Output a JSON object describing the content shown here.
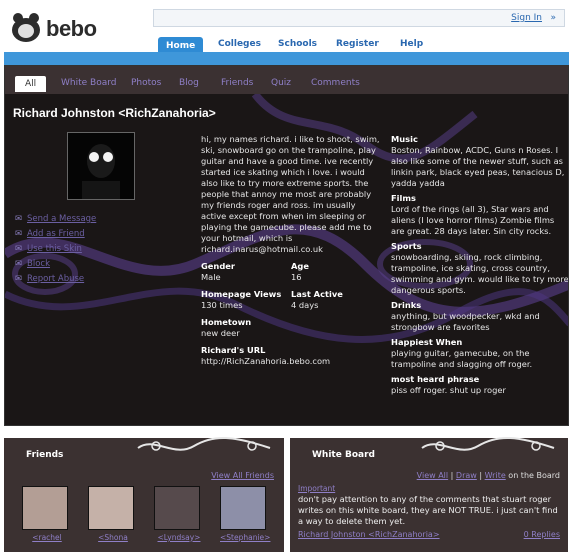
{
  "brand": {
    "logo_text": "bebo"
  },
  "header": {
    "sign_in": "Sign In",
    "sign_in_arrow": "»"
  },
  "nav": {
    "items": [
      {
        "label": "Home",
        "active": true
      },
      {
        "label": "Colleges"
      },
      {
        "label": "Schools"
      },
      {
        "label": "Register"
      },
      {
        "label": "Help"
      }
    ]
  },
  "tabs": [
    "All",
    "White Board",
    "Photos",
    "Blog",
    "Friends",
    "Quiz",
    "Comments"
  ],
  "profile": {
    "name": "Richard Johnston <RichZanahoria>",
    "actions": [
      "Send a Message",
      "Add as Friend",
      "Use this Skin",
      "Block",
      "Report Abuse"
    ],
    "bio": "hi, my names richard. i like to shoot, swim, ski, snowboard go on the trampoline, play guitar and have a good time. ive recently started ice skating which i love. i would also like to try more extreme sports. the people that annoy me most are probably my friends roger and ross. im usually active except from when im sleeping or playing the gamecube. please add me to your hotmail, which is richard.inarus@hotmail.co.uk",
    "gender_label": "Gender",
    "gender": "Male",
    "age_label": "Age",
    "age": "16",
    "views_label": "Homepage Views",
    "views": "130 times",
    "active_label": "Last Active",
    "active": "4 days",
    "hometown_label": "Hometown",
    "hometown": "new deer",
    "url_label": "Richard's URL",
    "url": "http://RichZanahoria.bebo.com",
    "music_label": "Music",
    "music": "Boston, Rainbow, ACDC, Guns n Roses. I also like some of the newer stuff, such as linkin park, black eyed peas, tenacious D, yadda yadda",
    "films_label": "Films",
    "films": "Lord of the rings (all 3), Star wars and aliens (I love horror films) Zombie films are great. 28 days later. Sin city rocks.",
    "sports_label": "Sports",
    "sports": "snowboarding, skiing, rock climbing, trampoline, ice skating, cross country, swimming and gym. would like to try more dangerous sports.",
    "drinks_label": "Drinks",
    "drinks": "anything, but woodpecker, wkd and strongbow are favorites",
    "happiest_label": "Happiest When",
    "happiest": "playing guitar, gamecube, on the trampoline and slagging off roger.",
    "phrase_label": "most heard phrase",
    "phrase": "piss off roger. shut up roger"
  },
  "friends": {
    "title": "Friends",
    "view_all": "View All Friends",
    "items": [
      "<rachel",
      "<Shona",
      "<Lyndsay>",
      "<Stephanie>"
    ]
  },
  "whiteboard": {
    "title": "White Board",
    "view_all": "View All",
    "sep1": "|",
    "draw": "Draw",
    "sep2": "|",
    "write": "Write",
    "suffix": "on the Board",
    "time": "Important",
    "text": "don't pay attention to any of the comments that stuart roger writes on this white board, they are NOT TRUE. i just can't find a way to delete them yet.",
    "author": "Richard Johnston <RichZanahoria>",
    "reply": "0 Replies"
  }
}
